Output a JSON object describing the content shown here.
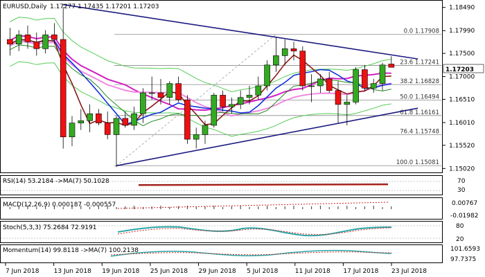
{
  "header": {
    "title": "EURUSD,Daily",
    "ohlc": "1.17277 1.17435 1.17201 1.17203"
  },
  "price_axis": {
    "ticks": [
      "1.18490",
      "1.17990",
      "1.17500",
      "1.17000",
      "1.16510",
      "1.16010",
      "1.15520",
      "1.15020"
    ],
    "current_price": "1.17203",
    "current_price_color": "#cc0000"
  },
  "fib_levels": [
    {
      "label": "0.0 1.17908",
      "price": 1.17908
    },
    {
      "label": "23.6 1.17241",
      "price": 1.17241
    },
    {
      "label": "38.2 1.16828",
      "price": 1.16828
    },
    {
      "label": "50.0 1.16494",
      "price": 1.16494
    },
    {
      "label": "61.8 1.16161",
      "price": 1.16161
    },
    {
      "label": "76.4 1.15748",
      "price": 1.15748
    },
    {
      "label": "100.0 1.15081",
      "price": 1.15081
    }
  ],
  "indicators": {
    "rsi": {
      "label": "RSI(14) 53.2184  ->MA(7) 50.1028",
      "ticks": [
        "70",
        "30"
      ]
    },
    "macd": {
      "label": "MACD(12,26,9) 0.000187 -0.000557",
      "ticks": [
        "0.00767",
        "-0.01982"
      ]
    },
    "stoch": {
      "label": "Stoch(5,3,3) 75.2684 72.9191",
      "ticks": [
        "80",
        "20"
      ]
    },
    "momentum": {
      "label": "Momentum(14) 99.8118  ->MA(7) 100.2138",
      "ticks": [
        "101.6593",
        "97.7375"
      ]
    }
  },
  "x_axis": {
    "labels": [
      "7 Jun 2018",
      "13 Jun 2018",
      "19 Jun 2018",
      "25 Jun 2018",
      "29 Jun 2018",
      "5 Jul 2018",
      "11 Jul 2018",
      "17 Jul 2018",
      "23 Jul 2018"
    ]
  },
  "colors": {
    "bull": "#33aa22",
    "bear": "#ee1111",
    "trendline": "#1a1a80",
    "magenta_ma": "#d020c0",
    "pink_ma": "#f08ae0",
    "blue_ma": "#1030e0",
    "brown_ma": "#8b1a1a",
    "green_ma": "#228822",
    "bollinger": "#55cc55"
  },
  "chart_data": {
    "type": "candlestick",
    "symbol": "EURUSD",
    "timeframe": "Daily",
    "ylim": [
      1.1495,
      1.1862
    ],
    "candles": [
      {
        "o": 1.178,
        "h": 1.1805,
        "l": 1.1745,
        "c": 1.177
      },
      {
        "o": 1.177,
        "h": 1.18,
        "l": 1.1755,
        "c": 1.179
      },
      {
        "o": 1.179,
        "h": 1.181,
        "l": 1.176,
        "c": 1.1775
      },
      {
        "o": 1.1775,
        "h": 1.1795,
        "l": 1.1745,
        "c": 1.176
      },
      {
        "o": 1.176,
        "h": 1.18,
        "l": 1.175,
        "c": 1.179
      },
      {
        "o": 1.179,
        "h": 1.1815,
        "l": 1.177,
        "c": 1.178
      },
      {
        "o": 1.178,
        "h": 1.185,
        "l": 1.1545,
        "c": 1.157
      },
      {
        "o": 1.157,
        "h": 1.1615,
        "l": 1.155,
        "c": 1.16
      },
      {
        "o": 1.16,
        "h": 1.163,
        "l": 1.1585,
        "c": 1.1605
      },
      {
        "o": 1.1605,
        "h": 1.164,
        "l": 1.158,
        "c": 1.162
      },
      {
        "o": 1.162,
        "h": 1.163,
        "l": 1.1595,
        "c": 1.16
      },
      {
        "o": 1.16,
        "h": 1.1625,
        "l": 1.1565,
        "c": 1.1575
      },
      {
        "o": 1.1575,
        "h": 1.1615,
        "l": 1.1505,
        "c": 1.161
      },
      {
        "o": 1.161,
        "h": 1.1625,
        "l": 1.159,
        "c": 1.1595
      },
      {
        "o": 1.1595,
        "h": 1.1635,
        "l": 1.1585,
        "c": 1.162
      },
      {
        "o": 1.162,
        "h": 1.1675,
        "l": 1.16,
        "c": 1.1665
      },
      {
        "o": 1.1665,
        "h": 1.17,
        "l": 1.165,
        "c": 1.1665
      },
      {
        "o": 1.1665,
        "h": 1.1695,
        "l": 1.164,
        "c": 1.1655
      },
      {
        "o": 1.1655,
        "h": 1.169,
        "l": 1.164,
        "c": 1.1685
      },
      {
        "o": 1.1685,
        "h": 1.17,
        "l": 1.1645,
        "c": 1.165
      },
      {
        "o": 1.165,
        "h": 1.166,
        "l": 1.1555,
        "c": 1.1565
      },
      {
        "o": 1.1565,
        "h": 1.159,
        "l": 1.1545,
        "c": 1.1575
      },
      {
        "o": 1.1575,
        "h": 1.1605,
        "l": 1.1555,
        "c": 1.1595
      },
      {
        "o": 1.1595,
        "h": 1.1665,
        "l": 1.159,
        "c": 1.166
      },
      {
        "o": 1.166,
        "h": 1.167,
        "l": 1.1625,
        "c": 1.1635
      },
      {
        "o": 1.1635,
        "h": 1.1655,
        "l": 1.162,
        "c": 1.164
      },
      {
        "o": 1.164,
        "h": 1.167,
        "l": 1.163,
        "c": 1.1655
      },
      {
        "o": 1.1655,
        "h": 1.168,
        "l": 1.164,
        "c": 1.166
      },
      {
        "o": 1.166,
        "h": 1.17,
        "l": 1.165,
        "c": 1.168
      },
      {
        "o": 1.168,
        "h": 1.1735,
        "l": 1.167,
        "c": 1.1725
      },
      {
        "o": 1.1725,
        "h": 1.1785,
        "l": 1.171,
        "c": 1.1745
      },
      {
        "o": 1.1745,
        "h": 1.178,
        "l": 1.1725,
        "c": 1.176
      },
      {
        "o": 1.176,
        "h": 1.1775,
        "l": 1.1735,
        "c": 1.1755
      },
      {
        "o": 1.1755,
        "h": 1.1765,
        "l": 1.167,
        "c": 1.168
      },
      {
        "o": 1.168,
        "h": 1.1705,
        "l": 1.1645,
        "c": 1.168
      },
      {
        "o": 1.168,
        "h": 1.1705,
        "l": 1.1665,
        "c": 1.1695
      },
      {
        "o": 1.1695,
        "h": 1.171,
        "l": 1.1665,
        "c": 1.167
      },
      {
        "o": 1.167,
        "h": 1.169,
        "l": 1.16,
        "c": 1.164
      },
      {
        "o": 1.164,
        "h": 1.166,
        "l": 1.1595,
        "c": 1.1645
      },
      {
        "o": 1.1645,
        "h": 1.172,
        "l": 1.164,
        "c": 1.1715
      },
      {
        "o": 1.1715,
        "h": 1.1725,
        "l": 1.167,
        "c": 1.1675
      },
      {
        "o": 1.1675,
        "h": 1.1695,
        "l": 1.1665,
        "c": 1.1685
      },
      {
        "o": 1.1685,
        "h": 1.173,
        "l": 1.167,
        "c": 1.1725
      },
      {
        "o": 1.1727,
        "h": 1.1744,
        "l": 1.172,
        "c": 1.172
      }
    ],
    "trendlines": [
      {
        "from": [
          6,
          1.1855
        ],
        "to": [
          46,
          1.1738
        ]
      },
      {
        "from": [
          12,
          1.1508
        ],
        "to": [
          46,
          1.1632
        ]
      }
    ],
    "title": "EURUSD,Daily"
  }
}
